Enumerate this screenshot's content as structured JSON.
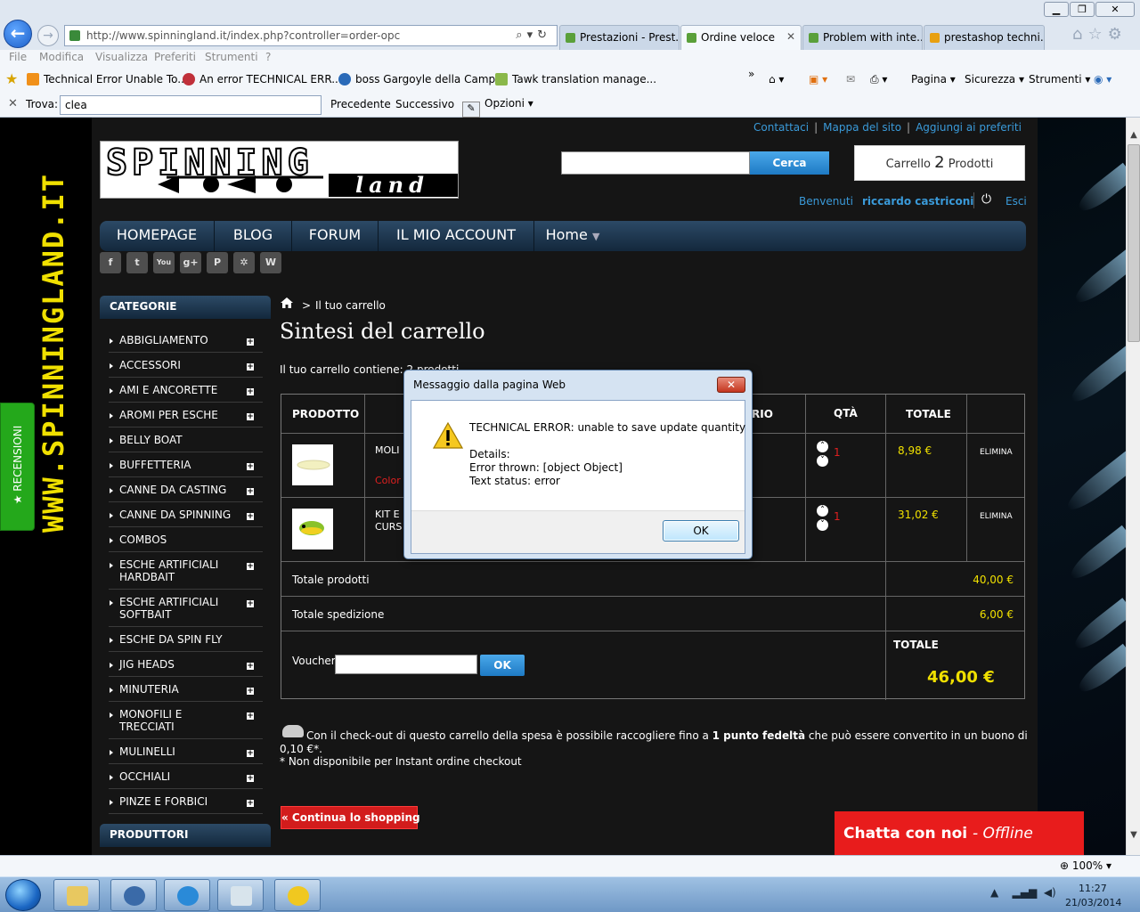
{
  "window": {
    "minimize": "▁",
    "maximize": "❐",
    "close": "✕"
  },
  "browser": {
    "url": "http://www.spinningland.it/index.php?controller=order-opc",
    "tabs": [
      {
        "label": "Prestazioni - Prest..."
      },
      {
        "label": "Ordine veloce"
      },
      {
        "label": "Problem with inte..."
      },
      {
        "label": "prestashop techni..."
      }
    ],
    "menu": [
      "File",
      "Modifica",
      "Visualizza",
      "Preferiti",
      "Strumenti",
      "?"
    ],
    "favorites": [
      "Technical Error Unable To...",
      "An error TECHNICAL ERR...",
      "boss Gargoyle della Camp...",
      "Tawk translation manage..."
    ],
    "commands": {
      "page": "Pagina",
      "security": "Sicurezza",
      "tools": "Strumenti"
    },
    "find": {
      "label": "Trova:",
      "value": "clea",
      "prev": "Precedente",
      "next": "Successivo",
      "options": "Opzioni"
    },
    "zoom": "100%"
  },
  "site": {
    "brand_vertical": "WWW.SPINNINGLAND.IT",
    "reviews_tab": "★ RECENSIONI",
    "logo_line1": "SPINNING",
    "logo_line2": "land",
    "top_links": [
      "Contattaci",
      "Mappa del sito",
      "Aggiungi ai preferiti"
    ],
    "search_button": "Cerca",
    "cart_box": {
      "prefix": "Carrello",
      "count": "2",
      "suffix": "Prodotti"
    },
    "welcome": "Benvenuti",
    "user": "riccardo castriconi",
    "logout": "Esci",
    "nav": [
      "HOMEPAGE",
      "BLOG",
      "FORUM",
      "IL MIO ACCOUNT",
      "Home"
    ],
    "social": [
      "f",
      "t",
      "You",
      "g+",
      "P",
      "✲",
      "W"
    ],
    "categories_title": "CATEGORIE",
    "categories": [
      {
        "label": "ABBIGLIAMENTO",
        "plus": true
      },
      {
        "label": "ACCESSORI",
        "plus": true
      },
      {
        "label": "AMI E ANCORETTE",
        "plus": true
      },
      {
        "label": "AROMI PER ESCHE",
        "plus": true
      },
      {
        "label": "BELLY BOAT",
        "plus": false
      },
      {
        "label": "BUFFETTERIA",
        "plus": true
      },
      {
        "label": "CANNE DA CASTING",
        "plus": true
      },
      {
        "label": "CANNE DA SPINNING",
        "plus": true
      },
      {
        "label": "COMBOS",
        "plus": false
      },
      {
        "label": "ESCHE ARTIFICIALI HARDBAIT",
        "plus": true
      },
      {
        "label": "ESCHE ARTIFICIALI SOFTBAIT",
        "plus": true
      },
      {
        "label": "ESCHE DA SPIN FLY",
        "plus": false
      },
      {
        "label": "JIG HEADS",
        "plus": true
      },
      {
        "label": "MINUTERIA",
        "plus": true
      },
      {
        "label": "MONOFILI E TRECCIATI",
        "plus": true
      },
      {
        "label": "MULINELLI",
        "plus": true
      },
      {
        "label": "OCCHIALI",
        "plus": true
      },
      {
        "label": "PINZE E FORBICI",
        "plus": true
      }
    ],
    "producers_title": "PRODUTTORI"
  },
  "cart": {
    "breadcrumb": "Il tuo carrello",
    "title": "Sintesi del carrello",
    "count_text": "Il tuo carrello contiene: 2 prodotti",
    "headers": {
      "product": "PRODOTTO",
      "price": "RIO",
      "qty": "QTÀ",
      "total": "TOTALE"
    },
    "rows": [
      {
        "name": "MOLI",
        "color": "Color",
        "qty": "1",
        "total": "8,98 €",
        "delete": "ELIMINA"
      },
      {
        "name": "KIT E",
        "name2": "CURS",
        "qty": "1",
        "total": "31,02 €",
        "delete": "ELIMINA"
      }
    ],
    "totals": {
      "products_label": "Totale prodotti",
      "products_value": "40,00 €",
      "shipping_label": "Totale spedizione",
      "shipping_value": "6,00 €",
      "voucher_label": "Voucher",
      "voucher_button": "OK",
      "grand_label": "TOTALE",
      "grand_value": "46,00 €"
    },
    "loyalty_pre": "Con il check-out di questo carrello della spesa è possibile raccogliere fino a",
    "loyalty_bold": "1 punto fedeltà",
    "loyalty_post": "che può essere convertito in un buono di 0,10 €*.",
    "loyalty_note": "* Non disponibile per Instant ordine checkout",
    "continue": "« Continua lo shopping",
    "chat_label": "Chatta con noi",
    "chat_status": "- Offline"
  },
  "dialog": {
    "title": "Messaggio dalla pagina Web",
    "message": "TECHNICAL ERROR: unable to save update quantity",
    "details_label": "Details:",
    "error_thrown": "Error thrown: [object Object]",
    "text_status": "Text status: error",
    "ok": "OK"
  },
  "taskbar": {
    "time": "11:27",
    "date": "21/03/2014"
  }
}
